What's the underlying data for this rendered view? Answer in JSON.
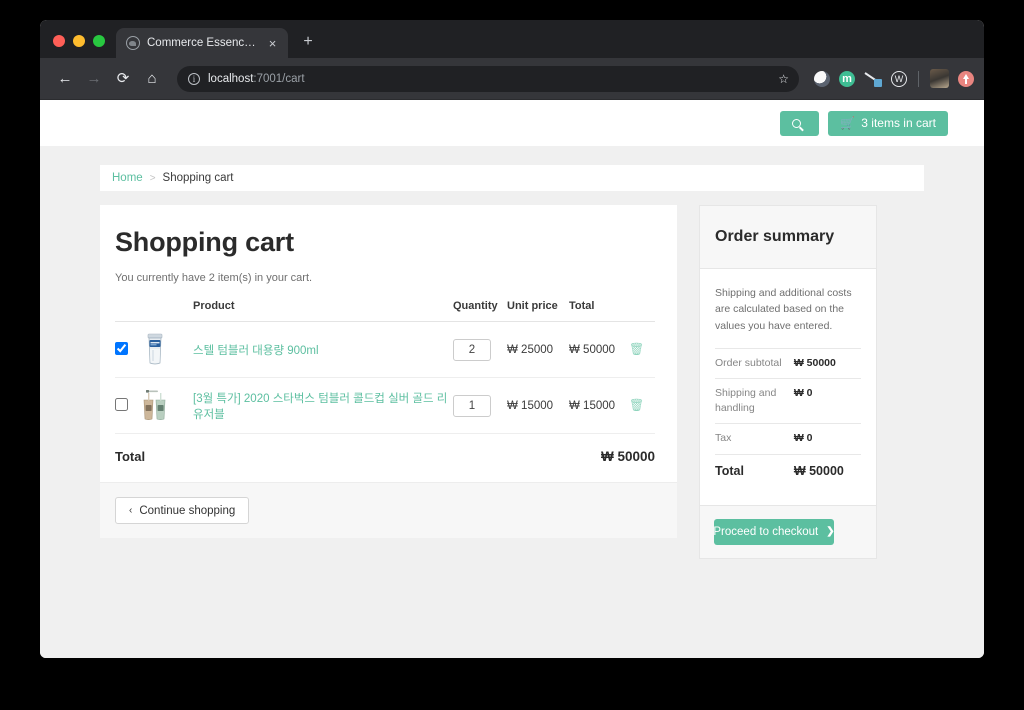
{
  "browser": {
    "tab_title": "Commerce Essence - Mall",
    "tab_close": "×",
    "new_tab": "+",
    "back": "←",
    "forward": "→",
    "reload": "⟳",
    "home": "⌂",
    "url_host": "localhost",
    "url_path": ":7001/cart",
    "star": "☆",
    "info": "ⓘ"
  },
  "header": {
    "search_label": "",
    "cart_label": "3 items in cart",
    "cart_icon": "🛒",
    "accent": "#5cbfa0"
  },
  "breadcrumb": {
    "home": "Home",
    "separator": ">",
    "current": "Shopping cart"
  },
  "cart": {
    "title": "Shopping cart",
    "subtitle": "You currently have 2 item(s) in your cart.",
    "columns": {
      "product": "Product",
      "quantity": "Quantity",
      "unit_price": "Unit price",
      "total": "Total"
    },
    "items": [
      {
        "selected": true,
        "name": "스텔 텀블러 대용량 900ml",
        "quantity": "2",
        "unit_price": "₩ 25000",
        "total": "₩ 50000",
        "delete_icon": "🗑"
      },
      {
        "selected": false,
        "name": "[3월 특가] 2020 스타벅스 텀블러 콜드컵 실버 골드 리유저블",
        "quantity": "1",
        "unit_price": "₩ 15000",
        "total": "₩ 15000",
        "delete_icon": "🗑"
      }
    ],
    "total_label": "Total",
    "total_amount": "₩ 50000",
    "continue_label": "Continue shopping",
    "continue_chevron": "‹"
  },
  "summary": {
    "title": "Order summary",
    "note": "Shipping and additional costs are calculated based on the values you have entered.",
    "rows": [
      {
        "label": "Order subtotal",
        "value": "₩ 50000"
      },
      {
        "label": "Shipping and handling",
        "value": "₩ 0"
      },
      {
        "label": "Tax",
        "value": "₩ 0"
      }
    ],
    "total_label": "Total",
    "total_value": "₩ 50000",
    "checkout_label": "Proceed to checkout",
    "checkout_chevron": "❯"
  }
}
